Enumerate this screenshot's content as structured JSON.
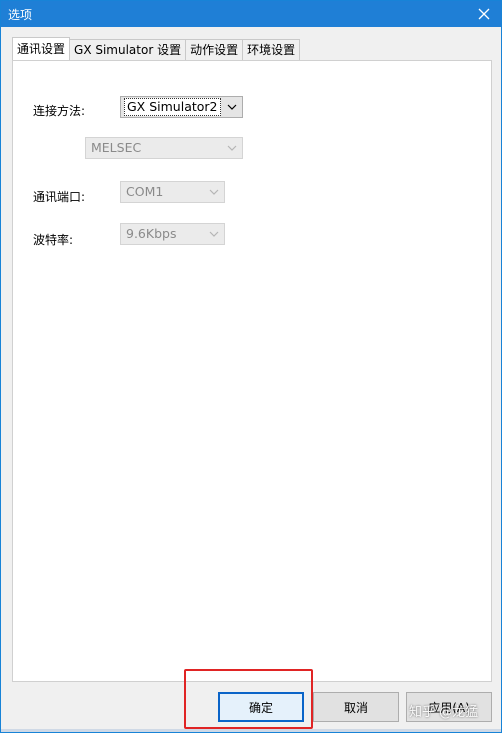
{
  "window": {
    "title": "选项"
  },
  "tabs": [
    {
      "label": "通讯设置",
      "active": true
    },
    {
      "label": "GX Simulator 设置",
      "active": false
    },
    {
      "label": "动作设置",
      "active": false
    },
    {
      "label": "环境设置",
      "active": false
    }
  ],
  "form": {
    "connection_method": {
      "label": "连接方法:",
      "value": "GX Simulator2",
      "enabled": true
    },
    "plc_type": {
      "value": "MELSEC",
      "enabled": false
    },
    "comm_port": {
      "label": "通讯端口:",
      "value": "COM1",
      "enabled": false
    },
    "baud_rate": {
      "label": "波特率:",
      "value": "9.6Kbps",
      "enabled": false
    }
  },
  "buttons": {
    "ok": "确定",
    "cancel": "取消",
    "apply": "应用(A)"
  },
  "watermark": "知乎 @龙猛",
  "colors": {
    "titlebar": "#1f7fd6",
    "highlight": "#e02424",
    "default_button_border": "#0a64c8"
  }
}
